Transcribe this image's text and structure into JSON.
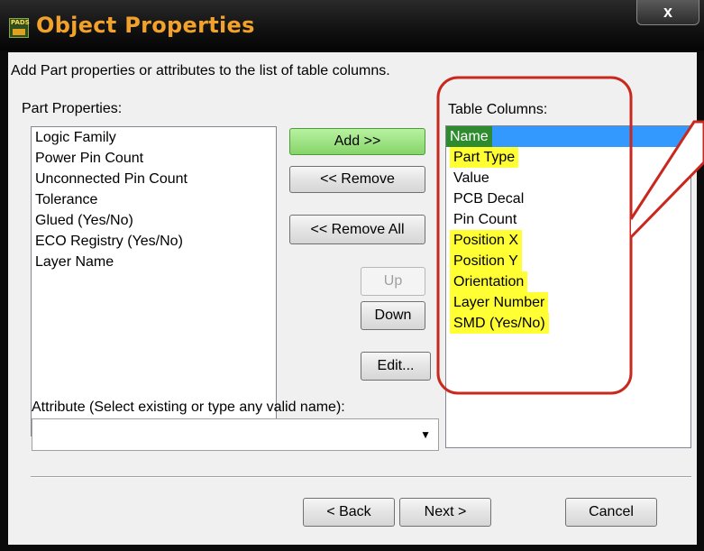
{
  "window": {
    "title": "Object Properties",
    "app_icon_text": "PADS",
    "close_glyph": "x"
  },
  "instructions": "Add Part properties or attributes to the list of table columns.",
  "part_properties": {
    "label": "Part Properties:",
    "items": [
      "Logic Family",
      "Power Pin Count",
      "Unconnected Pin Count",
      "Tolerance",
      "Glued (Yes/No)",
      "ECO Registry (Yes/No)",
      "Layer Name"
    ]
  },
  "buttons": {
    "add": "Add >>",
    "remove": "<< Remove",
    "remove_all": "<< Remove All",
    "up": "Up",
    "down": "Down",
    "edit": "Edit..."
  },
  "table_columns": {
    "label": "Table Columns:",
    "items": [
      {
        "label": "Name",
        "highlight": "selected"
      },
      {
        "label": "Part Type",
        "highlight": "yellow"
      },
      {
        "label": "Value",
        "highlight": "none"
      },
      {
        "label": "PCB Decal",
        "highlight": "none"
      },
      {
        "label": "Pin Count",
        "highlight": "none"
      },
      {
        "label": "Position X",
        "highlight": "yellow"
      },
      {
        "label": "Position Y",
        "highlight": "yellow"
      },
      {
        "label": "Orientation",
        "highlight": "yellow"
      },
      {
        "label": "Layer Number",
        "highlight": "yellow"
      },
      {
        "label": "SMD (Yes/No)",
        "highlight": "yellow"
      }
    ]
  },
  "attribute": {
    "label": "Attribute (Select existing or type any valid name):",
    "value": ""
  },
  "footer": {
    "back": "< Back",
    "next": "Next >",
    "cancel": "Cancel"
  },
  "colors": {
    "title_text": "#f2a22a",
    "selection_blue": "#3399ff",
    "selection_green": "#2e8b2e",
    "highlight_yellow": "#ffff33",
    "annotation_red": "#c8281e"
  }
}
